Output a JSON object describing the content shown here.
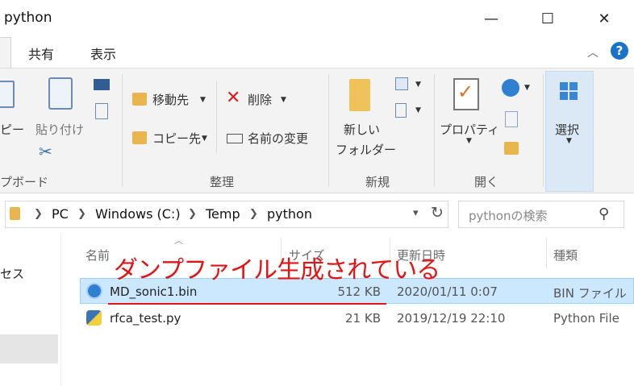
{
  "window": {
    "title": "python",
    "minimize": "—",
    "maximize": "☐",
    "close": "✕"
  },
  "ribbon_tabs": {
    "share": "共有",
    "view": "表示",
    "help": "?",
    "collapse": "︿"
  },
  "clipboard": {
    "copy": "ピー",
    "paste": "貼り付け",
    "group": "プボード"
  },
  "organize": {
    "move_to": "移動先",
    "copy_to": "コピー先",
    "delete": "削除",
    "rename": "名前の変更",
    "group": "整理"
  },
  "new_group": {
    "new_folder_line1": "新しい",
    "new_folder_line2": "フォルダー",
    "group": "新規"
  },
  "open_group": {
    "properties": "プロパティ",
    "group": "開く"
  },
  "select_group": {
    "select": "選択"
  },
  "address": {
    "crumbs": [
      "PC",
      "Windows (C:)",
      "Temp",
      "python"
    ]
  },
  "search": {
    "placeholder": "pythonの検索"
  },
  "nav": {
    "item_partial": "セス"
  },
  "columns": {
    "name": "名前",
    "size": "サイズ",
    "date": "更新日時",
    "type": "種類"
  },
  "files": [
    {
      "name": "MD_sonic1.bin",
      "size": "512 KB",
      "date": "2020/01/11 0:07",
      "type": "BIN ファイル"
    },
    {
      "name": "rfca_test.py",
      "size": "21 KB",
      "date": "2019/12/19 22:10",
      "type": "Python File"
    }
  ],
  "annotation": {
    "text": "ダンプファイル生成されている",
    "color": "#e41414"
  }
}
